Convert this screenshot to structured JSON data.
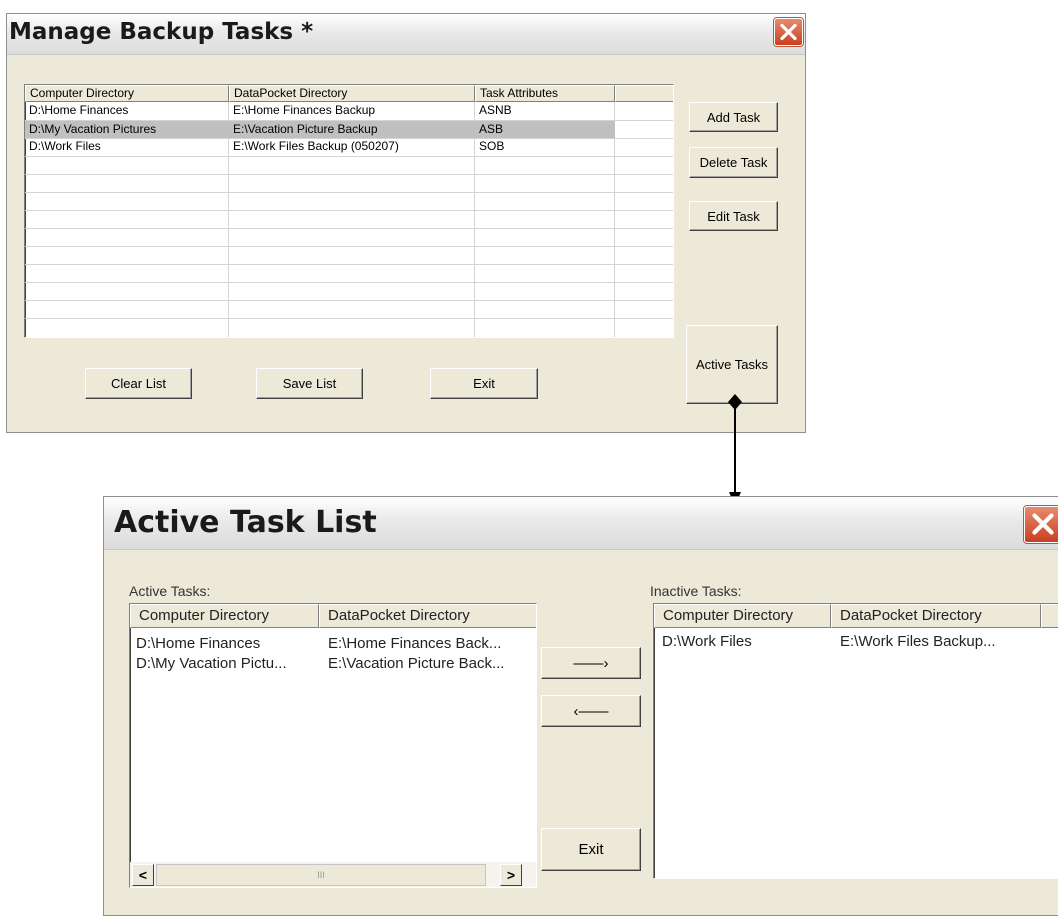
{
  "manage": {
    "title": "Manage Backup Tasks *",
    "columns": [
      "Computer Directory",
      "DataPocket Directory",
      "Task Attributes",
      ""
    ],
    "rows": [
      [
        "D:\\Home Finances",
        "E:\\Home Finances Backup",
        "ASNB"
      ],
      [
        "D:\\My Vacation Pictures",
        "E:\\Vacation Picture Backup",
        "ASB"
      ],
      [
        "D:\\Work Files",
        "E:\\Work Files Backup (050207)",
        "SOB"
      ]
    ],
    "selected_row": 1,
    "buttons": {
      "add_task": "Add Task",
      "delete_task": "Delete Task",
      "edit_task": "Edit Task",
      "active_tasks": "Active Tasks",
      "clear_list": "Clear List",
      "save_list": "Save List",
      "exit": "Exit"
    }
  },
  "active_list": {
    "title": "Active Task List",
    "active_label": "Active Tasks:",
    "inactive_label": "Inactive Tasks:",
    "columns": [
      "Computer Directory",
      "DataPocket Directory"
    ],
    "active_rows": [
      [
        "D:\\Home Finances",
        "E:\\Home Finances Back..."
      ],
      [
        "D:\\My Vacation Pictu...",
        "E:\\Vacation Picture Back..."
      ]
    ],
    "inactive_rows": [
      [
        "D:\\Work Files",
        "E:\\Work Files Backup..."
      ]
    ],
    "buttons": {
      "move_right": "——›",
      "move_left": "‹——",
      "exit": "Exit"
    },
    "scrollbar": {
      "left": "<",
      "right": ">",
      "thumb": "III"
    }
  },
  "colors": {
    "window_bg": "#ece9d8",
    "selection": "#c0c0c0",
    "close_red": "#c8401f"
  }
}
